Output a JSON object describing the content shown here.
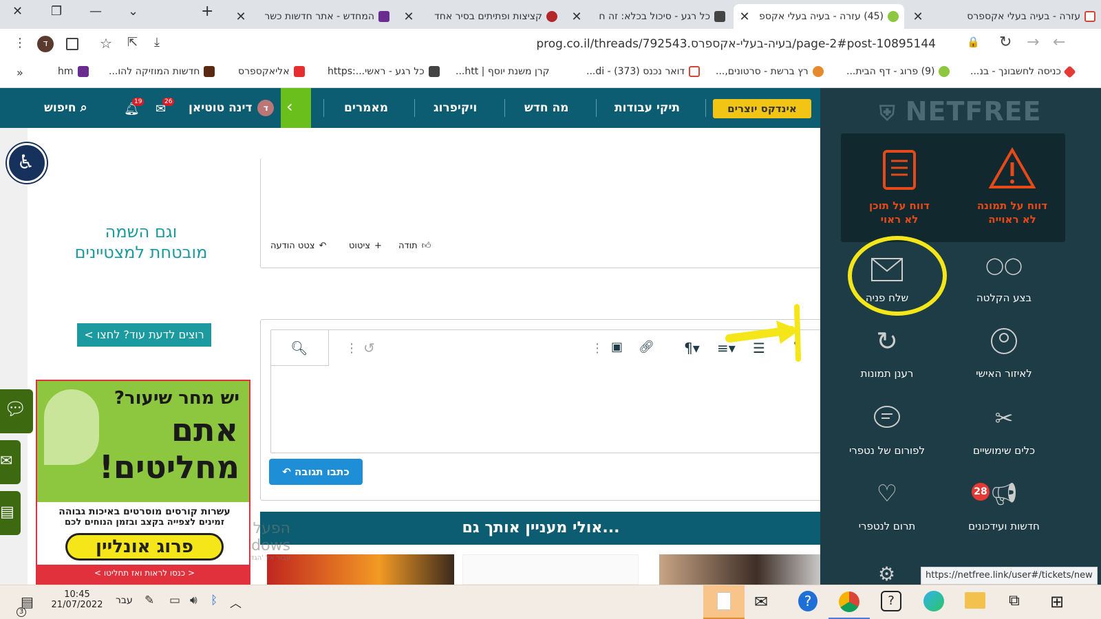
{
  "browser": {
    "tabs": [
      {
        "title": "עזרה - בעיה בעלי אקספרס"
      },
      {
        "title": "(45) עזרה - בעיה בעלי אקספ"
      },
      {
        "title": "כל רגע - סיכול בכלא: זה ח"
      },
      {
        "title": "קציצות ופתיתים בסיר אחד"
      },
      {
        "title": "המחדש - אתר חדשות כשר"
      }
    ],
    "url": "prog.co.il/threads/792543.בעיה-בעלי-אקספרס/page-2#post-10895144",
    "profile_initial": "ד",
    "bookmarks": [
      {
        "label": "כניסה לחשבונך - בנ..."
      },
      {
        "label": "(9) פרוג - דף הבית..."
      },
      {
        "label": "רץ ברשת - סרטונים,..."
      },
      {
        "label": "דואר נכנס (373) - di..."
      },
      {
        "label": "קרן משנת יוסף | htt..."
      },
      {
        "label": "כל רגע - ראשי...:https"
      },
      {
        "label": "אליאקספרס"
      },
      {
        "label": "חדשות המוזיקה להו..."
      },
      {
        "label": "hm"
      }
    ],
    "bookmarks_overflow": "»"
  },
  "site_nav": {
    "index_button": "אינדקס יוצרים",
    "items": [
      "תיקי עבודות",
      "מה חדש",
      "ויקיפרוג",
      "מאמרים"
    ],
    "user_name": "דינה טוטיאן",
    "user_initial": "ד",
    "messages_count": "26",
    "alerts_count": "19",
    "search_label": "חיפוש"
  },
  "post": {
    "actions": {
      "like": "תודה",
      "quote": "ציטוט",
      "share": "צטט הודעה"
    }
  },
  "reply": {
    "submit_label": "כתבו תגובה"
  },
  "related": {
    "title": "אולי מעניין אותך גם..."
  },
  "ads": {
    "top_line1": "וגם השמה",
    "top_line2": "מובטחת למצטיינים",
    "more_button": "רוצים לדעת עוד? לחצו >",
    "banner_q": "יש מחר שיעור?",
    "banner_big1": "אתם",
    "banner_big2": "מחליטים!",
    "banner_sub1": "עשרות קורסים מוסרטים באיכות גבוהה",
    "banner_sub2": "זמינים לצפייה בקצב ובזמן הנוחים לכם",
    "banner_brand": "פרוג אונליין",
    "banner_cta": "< כנסו לראות ואז תחליטו >"
  },
  "activation_watermark": {
    "line1": "הפעל את Windows",
    "line2": "עבור אל 'הגדרות' כדי להפעיל את Windows."
  },
  "netfree": {
    "logo": "NETFREE",
    "report_items": [
      {
        "line1": "דווח על תמונה",
        "line2": "לא ראוייה"
      },
      {
        "line1": "דווח על תוכן",
        "line2": "לא ראוי"
      }
    ],
    "items": [
      {
        "label": "בצע הקלטה",
        "icon": "voicemail-icon"
      },
      {
        "label": "שלח פניה",
        "icon": "envelope-icon"
      },
      {
        "label": "לאיזור האישי",
        "icon": "user-icon"
      },
      {
        "label": "רענן תמונות",
        "icon": "refresh-icon"
      },
      {
        "label": "כלים שימושיים",
        "icon": "tools-icon"
      },
      {
        "label": "לפורום של נטפרי",
        "icon": "chat-icon"
      },
      {
        "label": "חדשות ועידכונים",
        "icon": "megaphone-icon",
        "badge": "28"
      },
      {
        "label": "תרום לנטפרי",
        "icon": "heart-icon"
      }
    ]
  },
  "status_url": "https://netfree.link/user#/tickets/new",
  "taskbar": {
    "time": "10:45",
    "date": "21/07/2022",
    "lang": "עבר",
    "notifications": "3"
  },
  "colors": {
    "nav_bg": "#0c5d72",
    "netfree_bg": "#1d3c46",
    "accent_orange": "#e64a19",
    "highlight_yellow": "#f5e61a",
    "teal_button": "#1b9aa0",
    "reply_button": "#1e8fd6"
  }
}
